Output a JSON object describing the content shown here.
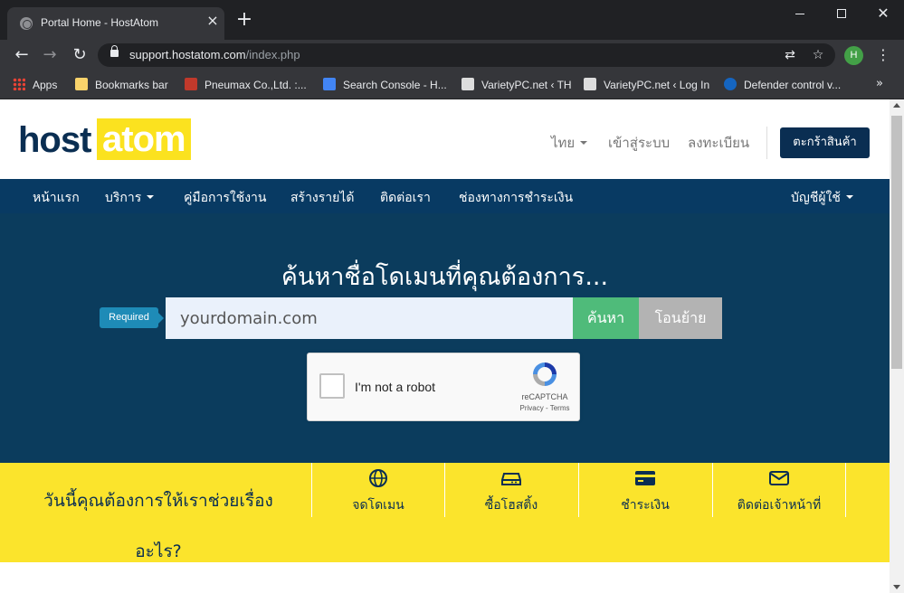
{
  "browser": {
    "tab_title": "Portal Home - HostAtom",
    "url_host": "support.hostatom.com",
    "url_path": "/index.php",
    "profile_initial": "H",
    "bookmarks": [
      "Apps",
      "Bookmarks bar",
      "Pneumax Co.,Ltd. :...",
      "Search Console - H...",
      "VarietyPC.net ‹ TH",
      "VarietyPC.net ‹ Log In",
      "Defender control v..."
    ],
    "more_bookmarks": "»"
  },
  "site": {
    "logo_host": "host",
    "logo_atom": "atom",
    "top_links": {
      "language": "ไทย",
      "login": "เข้าสู่ระบบ",
      "register": "ลงทะเบียน"
    },
    "cart_button": "ตะกร้าสินค้า",
    "nav": [
      "หน้าแรก",
      "บริการ",
      "คู่มือการใช้งาน",
      "สร้างรายได้",
      "ติดต่อเรา",
      "ช่องทางการชำระเงิน"
    ],
    "account": "บัญชีผู้ใช้",
    "hero_title": "ค้นหาชื่อโดเมนที่คุณต้องการ...",
    "required_badge": "Required",
    "domain_placeholder": "yourdomain.com",
    "search_button": "ค้นหา",
    "transfer_button": "โอนย้าย",
    "captcha": {
      "label": "I'm not a robot",
      "brand": "reCAPTCHA",
      "terms": "Privacy - Terms"
    },
    "help_question_line1": "วันนี้คุณต้องการให้เราช่วยเรื่อง",
    "help_question_line2": "อะไร?",
    "help_items": [
      {
        "label": "จดโดเมน",
        "icon": "globe-icon"
      },
      {
        "label": "ซื้อโฮสติ้ง",
        "icon": "server-icon"
      },
      {
        "label": "ชำระเงิน",
        "icon": "credit-card-icon"
      },
      {
        "label": "ติดต่อเจ้าหน้าที่",
        "icon": "envelope-icon"
      }
    ]
  },
  "colors": {
    "brand_navy": "#0a2e52",
    "nav_blue": "#083a63",
    "hero_blue": "#0b3c5d",
    "brand_yellow": "#fbe21f",
    "search_green": "#4fbb7a"
  }
}
